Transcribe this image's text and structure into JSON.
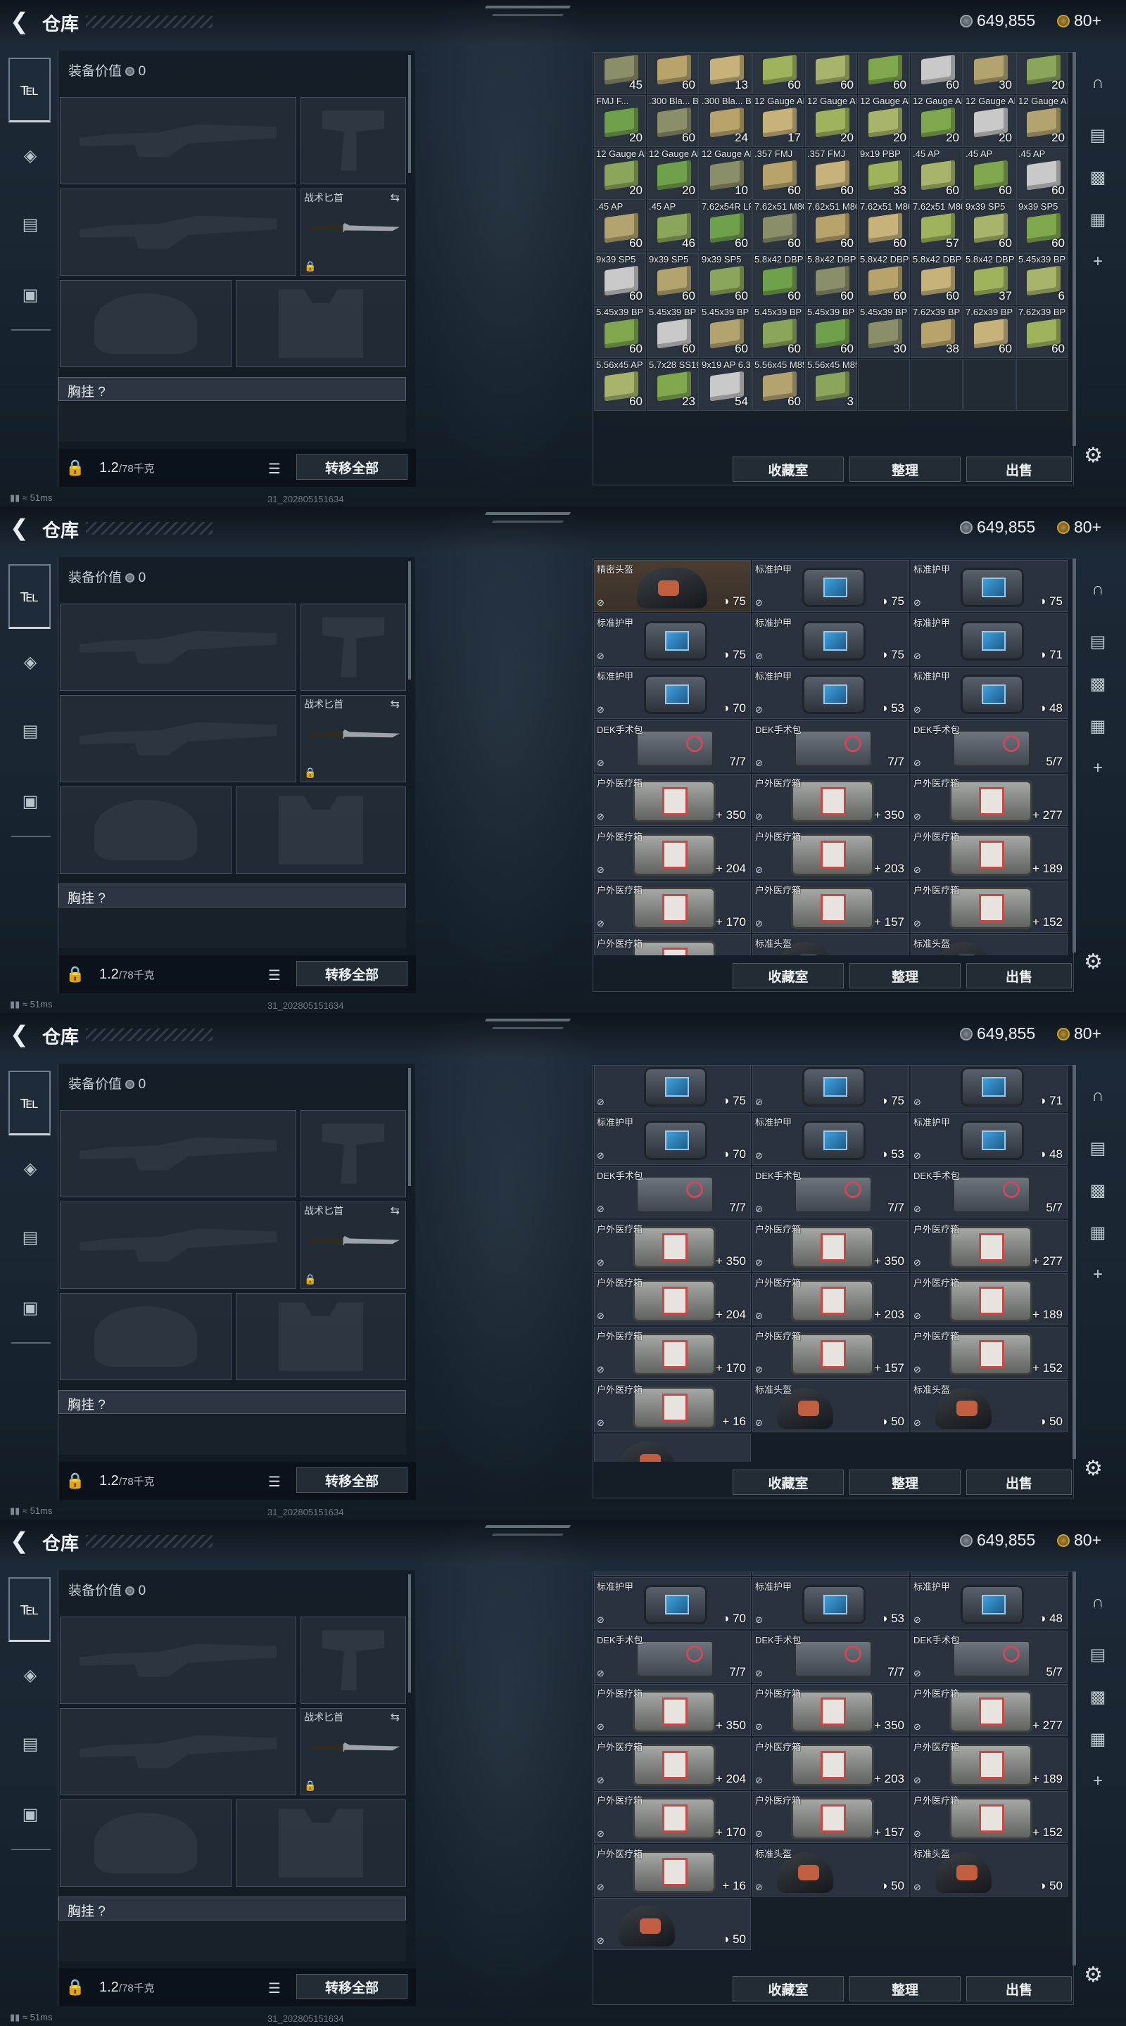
{
  "header": {
    "title": "仓库",
    "silver": "649,855",
    "gold": "80+"
  },
  "nav": {
    "items": [
      "weapons",
      "armor",
      "backpack",
      "supplies"
    ]
  },
  "equip": {
    "value_label": "装备价值",
    "value": "0",
    "knife_label": "战术匕首",
    "rig_label": "胸挂",
    "rig_q": "?",
    "weight": "1.2",
    "weight_max": "/78千克",
    "transfer": "转移全部"
  },
  "buttons": {
    "collect": "收藏室",
    "sort": "整理",
    "sell": "出售"
  },
  "status": {
    "ping": "51ms",
    "timestamp": "31_202805151634"
  },
  "ammo": [
    {
      "n": "",
      "c": "45"
    },
    {
      "n": "",
      "c": "60"
    },
    {
      "n": "",
      "c": "13"
    },
    {
      "n": "",
      "c": "60"
    },
    {
      "n": "",
      "c": "60"
    },
    {
      "n": "",
      "c": "60"
    },
    {
      "n": "",
      "c": "60"
    },
    {
      "n": "",
      "c": "30"
    },
    {
      "n": "",
      "c": "20"
    },
    {
      "n": "FMJ F...",
      "c": "20"
    },
    {
      "n": ".300 Bla... BC FMJ",
      "c": "60"
    },
    {
      "n": ".300 Bla... BCP FMJ",
      "c": "24"
    },
    {
      "n": "12 Gauge AP-20",
      "c": "17"
    },
    {
      "n": "12 Gauge AP-20",
      "c": "20"
    },
    {
      "n": "12 Gauge AP-20",
      "c": "20"
    },
    {
      "n": "12 Gauge AP-20",
      "c": "20"
    },
    {
      "n": "12 Gauge AP-20",
      "c": "20"
    },
    {
      "n": "12 Gauge AP-20",
      "c": "20"
    },
    {
      "n": "12 Gauge AP-20",
      "c": "20"
    },
    {
      "n": "12 Gauge AP-20",
      "c": "20"
    },
    {
      "n": "12 Gauge AP-20",
      "c": "10"
    },
    {
      "n": ".357 FMJ",
      "c": "60"
    },
    {
      "n": ".357 FMJ",
      "c": "60"
    },
    {
      "n": "9x19 PBP",
      "c": "33"
    },
    {
      "n": ".45 AP",
      "c": "60"
    },
    {
      "n": ".45 AP",
      "c": "60"
    },
    {
      "n": ".45 AP",
      "c": "60"
    },
    {
      "n": ".45 AP",
      "c": "60"
    },
    {
      "n": ".45 AP",
      "c": "46"
    },
    {
      "n": "7.62x54R LPS",
      "c": "60"
    },
    {
      "n": "7.62x51 M80",
      "c": "60"
    },
    {
      "n": "7.62x51 M80",
      "c": "60"
    },
    {
      "n": "7.62x51 M80",
      "c": "60"
    },
    {
      "n": "7.62x51 M80",
      "c": "57"
    },
    {
      "n": "9x39 SP5",
      "c": "60"
    },
    {
      "n": "9x39 SP5",
      "c": "60"
    },
    {
      "n": "9x39 SP5",
      "c": "60"
    },
    {
      "n": "9x39 SP5",
      "c": "60"
    },
    {
      "n": "9x39 SP5",
      "c": "60"
    },
    {
      "n": "5.8x42 DBP10",
      "c": "60"
    },
    {
      "n": "5.8x42 DBP10",
      "c": "60"
    },
    {
      "n": "5.8x42 DBP10",
      "c": "60"
    },
    {
      "n": "5.8x42 DBP10",
      "c": "60"
    },
    {
      "n": "5.8x42 DBP10",
      "c": "37"
    },
    {
      "n": "5.45x39 BP",
      "c": "6"
    },
    {
      "n": "5.45x39 BP",
      "c": "60"
    },
    {
      "n": "5.45x39 BP",
      "c": "60"
    },
    {
      "n": "5.45x39 BP",
      "c": "60"
    },
    {
      "n": "5.45x39 BP",
      "c": "60"
    },
    {
      "n": "5.45x39 BP",
      "c": "60"
    },
    {
      "n": "5.45x39 BP",
      "c": "30"
    },
    {
      "n": "7.62x39 BP",
      "c": "38"
    },
    {
      "n": "7.62x39 BP",
      "c": "60"
    },
    {
      "n": "7.62x39 BP",
      "c": "60"
    },
    {
      "n": "5.56x45 AP",
      "c": "60"
    },
    {
      "n": "5.7x28 SS190",
      "c": "23"
    },
    {
      "n": "9x19 AP 6.3",
      "c": "54"
    },
    {
      "n": "5.56x45 M855A1",
      "c": "60"
    },
    {
      "n": "5.56x45 M855A1",
      "c": "3"
    }
  ],
  "gear_a": [
    {
      "n": "精密头盔",
      "k": "helmetbig",
      "t": "75",
      "hl": true
    },
    {
      "n": "标准护甲",
      "k": "armor",
      "t": "75"
    },
    {
      "n": "标准护甲",
      "k": "armor",
      "t": "75"
    },
    {
      "n": "标准护甲",
      "k": "armor",
      "t": "75"
    },
    {
      "n": "标准护甲",
      "k": "armor",
      "t": "75"
    },
    {
      "n": "标准护甲",
      "k": "armor",
      "t": "71"
    },
    {
      "n": "标准护甲",
      "k": "armor",
      "t": "70"
    },
    {
      "n": "标准护甲",
      "k": "armor",
      "t": "53"
    },
    {
      "n": "标准护甲",
      "k": "armor",
      "t": "48"
    },
    {
      "n": "DEK手术包",
      "k": "surg",
      "t": "7/7"
    },
    {
      "n": "DEK手术包",
      "k": "surg",
      "t": "7/7"
    },
    {
      "n": "DEK手术包",
      "k": "surg",
      "t": "5/7"
    },
    {
      "n": "户外医疗箱",
      "k": "med",
      "t": "350"
    },
    {
      "n": "户外医疗箱",
      "k": "med",
      "t": "350"
    },
    {
      "n": "户外医疗箱",
      "k": "med",
      "t": "277"
    },
    {
      "n": "户外医疗箱",
      "k": "med",
      "t": "204"
    },
    {
      "n": "户外医疗箱",
      "k": "med",
      "t": "203"
    },
    {
      "n": "户外医疗箱",
      "k": "med",
      "t": "189"
    },
    {
      "n": "户外医疗箱",
      "k": "med",
      "t": "170"
    },
    {
      "n": "户外医疗箱",
      "k": "med",
      "t": "157"
    },
    {
      "n": "户外医疗箱",
      "k": "med",
      "t": "152"
    },
    {
      "n": "户外医疗箱",
      "k": "med",
      "t": ""
    },
    {
      "n": "标准头盔",
      "k": "helmet",
      "t": ""
    },
    {
      "n": "标准头盔",
      "k": "helmet",
      "t": ""
    }
  ],
  "gear_b": [
    {
      "n": "",
      "k": "armor",
      "t": "75"
    },
    {
      "n": "",
      "k": "armor",
      "t": "75"
    },
    {
      "n": "",
      "k": "armor",
      "t": "71"
    },
    {
      "n": "标准护甲",
      "k": "armor",
      "t": "70"
    },
    {
      "n": "标准护甲",
      "k": "armor",
      "t": "53"
    },
    {
      "n": "标准护甲",
      "k": "armor",
      "t": "48"
    },
    {
      "n": "DEK手术包",
      "k": "surg",
      "t": "7/7"
    },
    {
      "n": "DEK手术包",
      "k": "surg",
      "t": "7/7"
    },
    {
      "n": "DEK手术包",
      "k": "surg",
      "t": "5/7"
    },
    {
      "n": "户外医疗箱",
      "k": "med",
      "t": "350"
    },
    {
      "n": "户外医疗箱",
      "k": "med",
      "t": "350"
    },
    {
      "n": "户外医疗箱",
      "k": "med",
      "t": "277"
    },
    {
      "n": "户外医疗箱",
      "k": "med",
      "t": "204"
    },
    {
      "n": "户外医疗箱",
      "k": "med",
      "t": "203"
    },
    {
      "n": "户外医疗箱",
      "k": "med",
      "t": "189"
    },
    {
      "n": "户外医疗箱",
      "k": "med",
      "t": "170"
    },
    {
      "n": "户外医疗箱",
      "k": "med",
      "t": "157"
    },
    {
      "n": "户外医疗箱",
      "k": "med",
      "t": "152"
    },
    {
      "n": "户外医疗箱",
      "k": "med",
      "t": "16"
    },
    {
      "n": "标准头盔",
      "k": "helmet",
      "t": "50"
    },
    {
      "n": "标准头盔",
      "k": "helmet",
      "t": "50"
    },
    {
      "n": "",
      "k": "helmet",
      "t": "50"
    }
  ],
  "icons": {
    "back": "back-arrow-icon",
    "coin_silver": "silver-coin-icon",
    "coin_gold": "gold-coin-icon",
    "settings": "gear-icon"
  }
}
